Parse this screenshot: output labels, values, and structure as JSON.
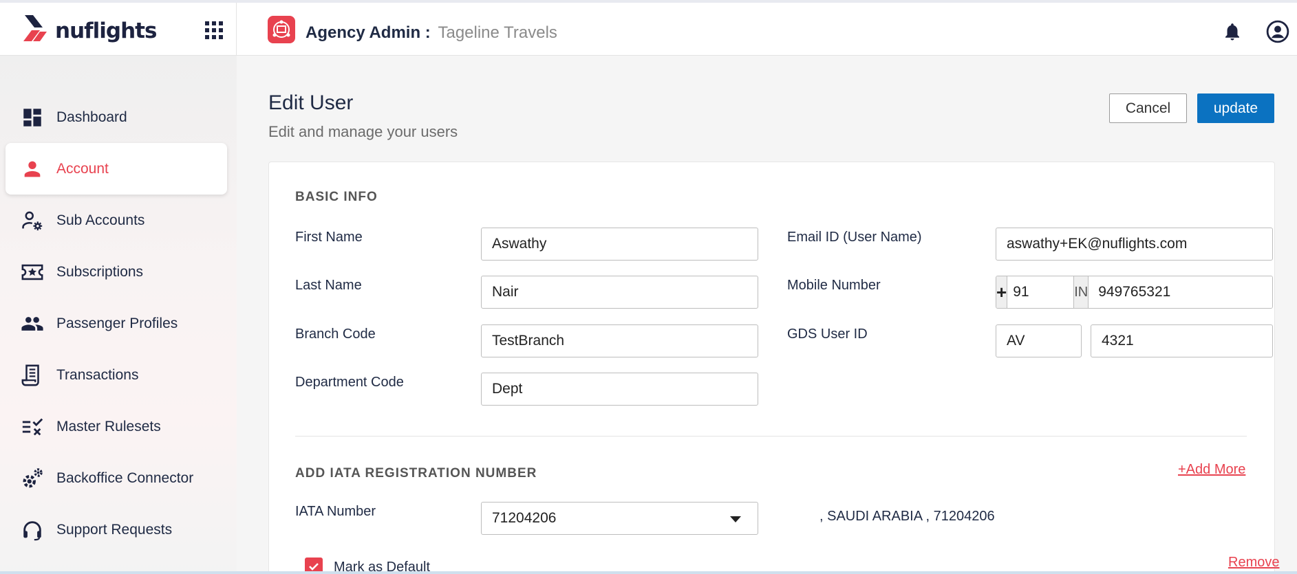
{
  "brand": {
    "name": "nuFlights",
    "logo_text": "nuflights",
    "accent": "#e8424f",
    "primary": "#0b72c1"
  },
  "header": {
    "admin_label": "Agency Admin :",
    "agency_name": "Tageline Travels",
    "icons": [
      "apps-grid-icon",
      "agency-icon",
      "bell-icon",
      "user-account-icon"
    ]
  },
  "sidebar": {
    "items": [
      {
        "label": "Dashboard",
        "icon": "dashboard-icon",
        "active": false
      },
      {
        "label": "Account",
        "icon": "person-icon",
        "active": true
      },
      {
        "label": "Sub Accounts",
        "icon": "user-gear-icon",
        "active": false
      },
      {
        "label": "Subscriptions",
        "icon": "ticket-star-icon",
        "active": false
      },
      {
        "label": "Passenger Profiles",
        "icon": "people-icon",
        "active": false
      },
      {
        "label": "Transactions",
        "icon": "receipt-icon",
        "active": false
      },
      {
        "label": "Master Rulesets",
        "icon": "checklist-icon",
        "active": false
      },
      {
        "label": "Backoffice Connector",
        "icon": "gears-icon",
        "active": false
      },
      {
        "label": "Support Requests",
        "icon": "headset-icon",
        "active": false
      }
    ]
  },
  "page": {
    "title": "Edit User",
    "subtitle": "Edit and manage your users",
    "cancel_label": "Cancel",
    "update_label": "update"
  },
  "basic_info": {
    "section_title": "BASIC INFO",
    "first_name": {
      "label": "First Name",
      "value": "Aswathy"
    },
    "last_name": {
      "label": "Last Name",
      "value": "Nair"
    },
    "branch_code": {
      "label": "Branch Code",
      "value": "TestBranch"
    },
    "department_code": {
      "label": "Department Code",
      "value": "Dept"
    },
    "email": {
      "label": "Email ID (User Name)",
      "value": "aswathy+EK@nuflights.com"
    },
    "mobile": {
      "label": "Mobile Number",
      "plus": "+",
      "country_code": "91",
      "country": "IN",
      "number": "949765321"
    },
    "gds": {
      "label": "GDS User ID",
      "prefix": "AV",
      "value": "4321"
    }
  },
  "iata": {
    "section_title": "ADD IATA REGISTRATION NUMBER",
    "add_more_label": "+Add More",
    "number_label": "IATA Number",
    "selected": "71204206",
    "description": ", SAUDI ARABIA , 71204206",
    "mark_default_label": "Mark as Default",
    "mark_default_checked": true,
    "remove_label": "Remove"
  }
}
